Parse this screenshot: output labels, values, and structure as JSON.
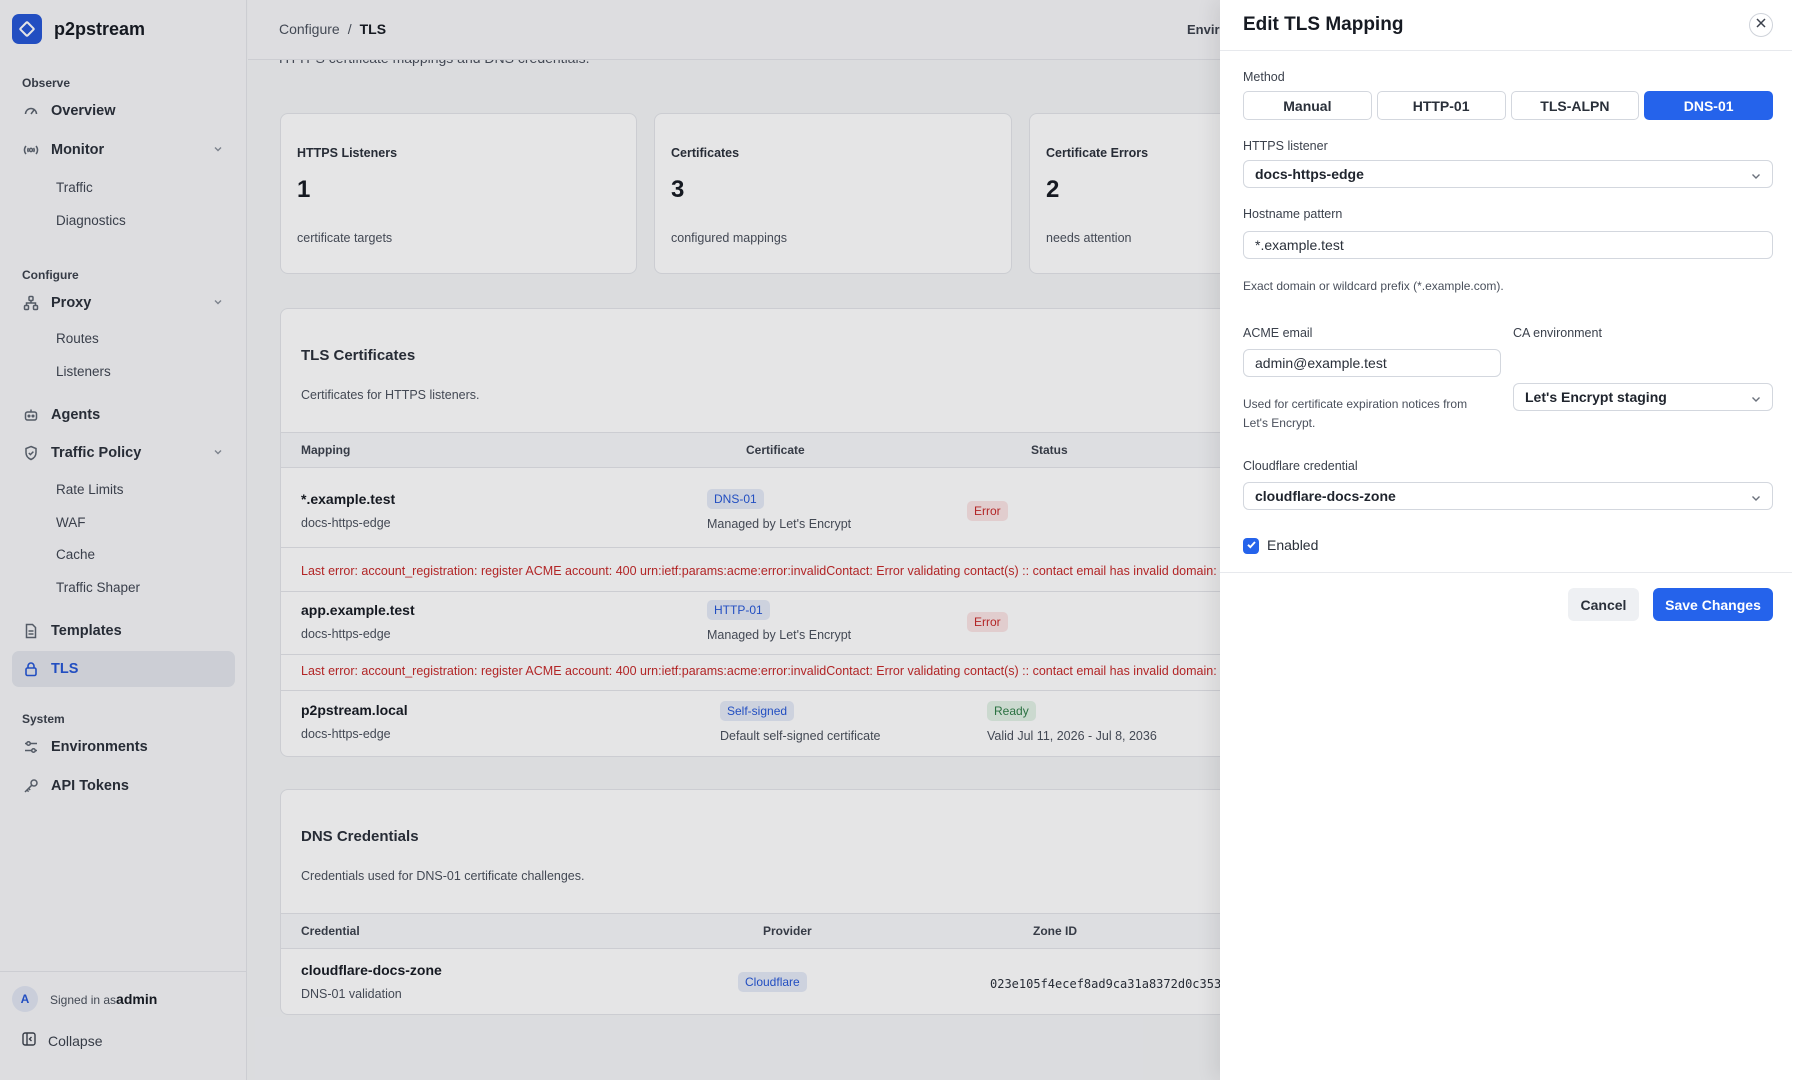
{
  "app": {
    "name": "p2pstream"
  },
  "sidebar": {
    "sections": {
      "observe": "Observe",
      "configure": "Configure",
      "system": "System"
    },
    "items": {
      "overview": "Overview",
      "monitor": "Monitor",
      "traffic": "Traffic",
      "diagnostics": "Diagnostics",
      "proxy": "Proxy",
      "routes": "Routes",
      "listeners": "Listeners",
      "agents": "Agents",
      "traffic_policy": "Traffic Policy",
      "rate_limits": "Rate Limits",
      "waf": "WAF",
      "cache": "Cache",
      "traffic_shaper": "Traffic Shaper",
      "templates": "Templates",
      "tls": "TLS",
      "environments": "Environments",
      "api_tokens": "API Tokens"
    },
    "footer": {
      "avatar_initial": "A",
      "signed_in_prefix": "Signed in as",
      "username": "admin",
      "collapse": "Collapse"
    }
  },
  "header": {
    "breadcrumb_parent": "Configure",
    "breadcrumb_sep": "/",
    "breadcrumb_current": "TLS",
    "env_label_cut": "Enviro",
    "subtitle_cut": "HTTPS certificate mappings and DNS credentials."
  },
  "stats": [
    {
      "title": "HTTPS Listeners",
      "value": "1",
      "note": "certificate targets"
    },
    {
      "title": "Certificates",
      "value": "3",
      "note": "configured mappings"
    },
    {
      "title": "Certificate Errors",
      "value": "2",
      "note": "needs attention"
    }
  ],
  "tls_panel": {
    "title": "TLS Certificates",
    "description": "Certificates for HTTPS listeners.",
    "columns": {
      "mapping": "Mapping",
      "certificate": "Certificate",
      "status": "Status"
    },
    "rows": [
      {
        "host": "*.example.test",
        "listener": "docs-https-edge",
        "method": "DNS-01",
        "cert_note": "Managed by Let's Encrypt",
        "status": "Error",
        "error": "Last error: account_registration: register ACME account: 400 urn:ietf:params:acme:error:invalidContact: Error validating contact(s) :: contact email has invalid domain: Dom"
      },
      {
        "host": "app.example.test",
        "listener": "docs-https-edge",
        "method": "HTTP-01",
        "cert_note": "Managed by Let's Encrypt",
        "status": "Error",
        "error": "Last error: account_registration: register ACME account: 400 urn:ietf:params:acme:error:invalidContact: Error validating contact(s) :: contact email has invalid domain: Dom"
      },
      {
        "host": "p2pstream.local",
        "listener": "docs-https-edge",
        "method": "Self-signed",
        "cert_note": "Default self-signed certificate",
        "status": "Ready",
        "validity": "Valid Jul 11, 2026 - Jul 8, 2036"
      }
    ]
  },
  "dns_panel": {
    "title": "DNS Credentials",
    "description": "Credentials used for DNS-01 certificate challenges.",
    "columns": {
      "credential": "Credential",
      "provider": "Provider",
      "zone_id": "Zone ID"
    },
    "rows": [
      {
        "name": "cloudflare-docs-zone",
        "note": "DNS-01 validation",
        "provider": "Cloudflare",
        "zone_id": "023e105f4ecef8ad9ca31a8372d0c353"
      }
    ]
  },
  "drawer": {
    "title": "Edit TLS Mapping",
    "method_label": "Method",
    "methods": [
      "Manual",
      "HTTP-01",
      "TLS-ALPN",
      "DNS-01"
    ],
    "selected_method": "DNS-01",
    "listener_label": "HTTPS listener",
    "listener_value": "docs-https-edge",
    "hostname_label": "Hostname pattern",
    "hostname_value": "*.example.test",
    "hostname_help": "Exact domain or wildcard prefix (*.example.com).",
    "email_label": "ACME email",
    "email_value": "admin@example.test",
    "email_help": "Used for certificate expiration notices from Let's Encrypt.",
    "ca_label": "CA environment",
    "ca_value": "Let's Encrypt staging",
    "cloudflare_label": "Cloudflare credential",
    "cloudflare_value": "cloudflare-docs-zone",
    "enabled_label": "Enabled",
    "enabled": true,
    "cancel_label": "Cancel",
    "save_label": "Save Changes"
  },
  "colors": {
    "accent": "#2563eb",
    "error": "#c62828",
    "success": "#2e7d46"
  }
}
